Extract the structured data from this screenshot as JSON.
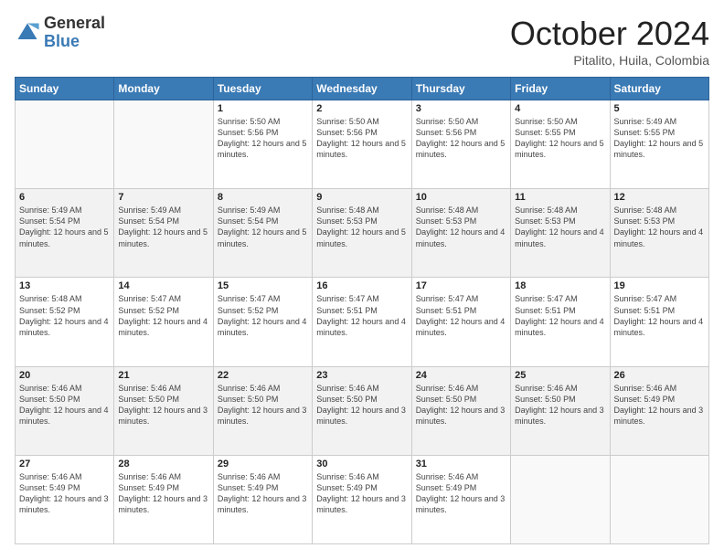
{
  "logo": {
    "general": "General",
    "blue": "Blue"
  },
  "title": {
    "month": "October 2024",
    "location": "Pitalito, Huila, Colombia"
  },
  "weekdays": [
    "Sunday",
    "Monday",
    "Tuesday",
    "Wednesday",
    "Thursday",
    "Friday",
    "Saturday"
  ],
  "weeks": [
    [
      {
        "day": "",
        "sunrise": "",
        "sunset": "",
        "daylight": ""
      },
      {
        "day": "",
        "sunrise": "",
        "sunset": "",
        "daylight": ""
      },
      {
        "day": "1",
        "sunrise": "Sunrise: 5:50 AM",
        "sunset": "Sunset: 5:56 PM",
        "daylight": "Daylight: 12 hours and 5 minutes."
      },
      {
        "day": "2",
        "sunrise": "Sunrise: 5:50 AM",
        "sunset": "Sunset: 5:56 PM",
        "daylight": "Daylight: 12 hours and 5 minutes."
      },
      {
        "day": "3",
        "sunrise": "Sunrise: 5:50 AM",
        "sunset": "Sunset: 5:56 PM",
        "daylight": "Daylight: 12 hours and 5 minutes."
      },
      {
        "day": "4",
        "sunrise": "Sunrise: 5:50 AM",
        "sunset": "Sunset: 5:55 PM",
        "daylight": "Daylight: 12 hours and 5 minutes."
      },
      {
        "day": "5",
        "sunrise": "Sunrise: 5:49 AM",
        "sunset": "Sunset: 5:55 PM",
        "daylight": "Daylight: 12 hours and 5 minutes."
      }
    ],
    [
      {
        "day": "6",
        "sunrise": "Sunrise: 5:49 AM",
        "sunset": "Sunset: 5:54 PM",
        "daylight": "Daylight: 12 hours and 5 minutes."
      },
      {
        "day": "7",
        "sunrise": "Sunrise: 5:49 AM",
        "sunset": "Sunset: 5:54 PM",
        "daylight": "Daylight: 12 hours and 5 minutes."
      },
      {
        "day": "8",
        "sunrise": "Sunrise: 5:49 AM",
        "sunset": "Sunset: 5:54 PM",
        "daylight": "Daylight: 12 hours and 5 minutes."
      },
      {
        "day": "9",
        "sunrise": "Sunrise: 5:48 AM",
        "sunset": "Sunset: 5:53 PM",
        "daylight": "Daylight: 12 hours and 5 minutes."
      },
      {
        "day": "10",
        "sunrise": "Sunrise: 5:48 AM",
        "sunset": "Sunset: 5:53 PM",
        "daylight": "Daylight: 12 hours and 4 minutes."
      },
      {
        "day": "11",
        "sunrise": "Sunrise: 5:48 AM",
        "sunset": "Sunset: 5:53 PM",
        "daylight": "Daylight: 12 hours and 4 minutes."
      },
      {
        "day": "12",
        "sunrise": "Sunrise: 5:48 AM",
        "sunset": "Sunset: 5:53 PM",
        "daylight": "Daylight: 12 hours and 4 minutes."
      }
    ],
    [
      {
        "day": "13",
        "sunrise": "Sunrise: 5:48 AM",
        "sunset": "Sunset: 5:52 PM",
        "daylight": "Daylight: 12 hours and 4 minutes."
      },
      {
        "day": "14",
        "sunrise": "Sunrise: 5:47 AM",
        "sunset": "Sunset: 5:52 PM",
        "daylight": "Daylight: 12 hours and 4 minutes."
      },
      {
        "day": "15",
        "sunrise": "Sunrise: 5:47 AM",
        "sunset": "Sunset: 5:52 PM",
        "daylight": "Daylight: 12 hours and 4 minutes."
      },
      {
        "day": "16",
        "sunrise": "Sunrise: 5:47 AM",
        "sunset": "Sunset: 5:51 PM",
        "daylight": "Daylight: 12 hours and 4 minutes."
      },
      {
        "day": "17",
        "sunrise": "Sunrise: 5:47 AM",
        "sunset": "Sunset: 5:51 PM",
        "daylight": "Daylight: 12 hours and 4 minutes."
      },
      {
        "day": "18",
        "sunrise": "Sunrise: 5:47 AM",
        "sunset": "Sunset: 5:51 PM",
        "daylight": "Daylight: 12 hours and 4 minutes."
      },
      {
        "day": "19",
        "sunrise": "Sunrise: 5:47 AM",
        "sunset": "Sunset: 5:51 PM",
        "daylight": "Daylight: 12 hours and 4 minutes."
      }
    ],
    [
      {
        "day": "20",
        "sunrise": "Sunrise: 5:46 AM",
        "sunset": "Sunset: 5:50 PM",
        "daylight": "Daylight: 12 hours and 4 minutes."
      },
      {
        "day": "21",
        "sunrise": "Sunrise: 5:46 AM",
        "sunset": "Sunset: 5:50 PM",
        "daylight": "Daylight: 12 hours and 3 minutes."
      },
      {
        "day": "22",
        "sunrise": "Sunrise: 5:46 AM",
        "sunset": "Sunset: 5:50 PM",
        "daylight": "Daylight: 12 hours and 3 minutes."
      },
      {
        "day": "23",
        "sunrise": "Sunrise: 5:46 AM",
        "sunset": "Sunset: 5:50 PM",
        "daylight": "Daylight: 12 hours and 3 minutes."
      },
      {
        "day": "24",
        "sunrise": "Sunrise: 5:46 AM",
        "sunset": "Sunset: 5:50 PM",
        "daylight": "Daylight: 12 hours and 3 minutes."
      },
      {
        "day": "25",
        "sunrise": "Sunrise: 5:46 AM",
        "sunset": "Sunset: 5:50 PM",
        "daylight": "Daylight: 12 hours and 3 minutes."
      },
      {
        "day": "26",
        "sunrise": "Sunrise: 5:46 AM",
        "sunset": "Sunset: 5:49 PM",
        "daylight": "Daylight: 12 hours and 3 minutes."
      }
    ],
    [
      {
        "day": "27",
        "sunrise": "Sunrise: 5:46 AM",
        "sunset": "Sunset: 5:49 PM",
        "daylight": "Daylight: 12 hours and 3 minutes."
      },
      {
        "day": "28",
        "sunrise": "Sunrise: 5:46 AM",
        "sunset": "Sunset: 5:49 PM",
        "daylight": "Daylight: 12 hours and 3 minutes."
      },
      {
        "day": "29",
        "sunrise": "Sunrise: 5:46 AM",
        "sunset": "Sunset: 5:49 PM",
        "daylight": "Daylight: 12 hours and 3 minutes."
      },
      {
        "day": "30",
        "sunrise": "Sunrise: 5:46 AM",
        "sunset": "Sunset: 5:49 PM",
        "daylight": "Daylight: 12 hours and 3 minutes."
      },
      {
        "day": "31",
        "sunrise": "Sunrise: 5:46 AM",
        "sunset": "Sunset: 5:49 PM",
        "daylight": "Daylight: 12 hours and 3 minutes."
      },
      {
        "day": "",
        "sunrise": "",
        "sunset": "",
        "daylight": ""
      },
      {
        "day": "",
        "sunrise": "",
        "sunset": "",
        "daylight": ""
      }
    ]
  ]
}
